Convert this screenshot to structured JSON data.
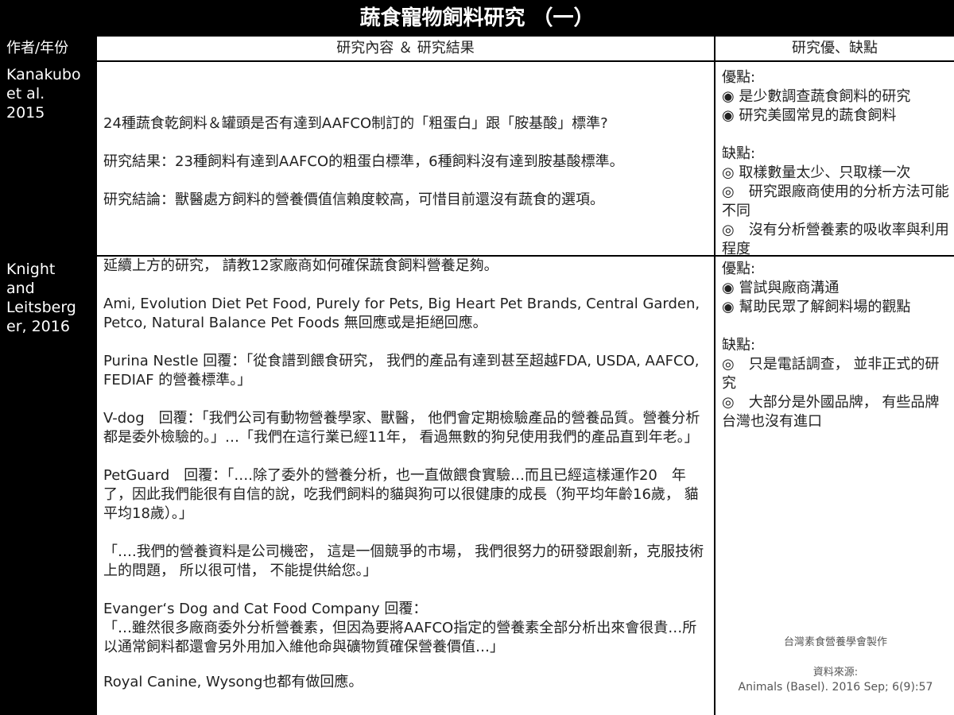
{
  "title": "蔬食寵物飼料研究 （一）",
  "headers": {
    "author": "作者/年份",
    "content": "研究內容 ＆ 研究結果",
    "evaluation": "研究優、缺點"
  },
  "rows": [
    {
      "author": "Kanakubo\net al.\n2015",
      "content": [
        "24種蔬食乾飼料＆罐頭是否有達到AAFCO制訂的「粗蛋白」跟「胺基酸」標準?",
        "研究結果：23種飼料有達到AAFCO的粗蛋白標準，6種飼料沒有達到胺基酸標準。",
        "研究結論：獸醫處方飼料的營養價值信賴度較高，可惜目前還沒有蔬食的選項。"
      ],
      "pros_label": "優點:",
      "pros": [
        "◉ 是少數調查蔬食飼料的研究",
        "◉ 研究美國常見的蔬食飼料"
      ],
      "cons_label": "缺點:",
      "cons": [
        "◎ 取樣數量太少、只取樣一次",
        "◎　研究跟廠商使用的分析方法可能不同",
        "◎　沒有分析營養素的吸收率與利用程度"
      ]
    },
    {
      "author": "Knight\nand\nLeitsberg\ner, 2016",
      "content": [
        "延續上方的研究， 請教12家廠商如何確保蔬食飼料營養足夠。",
        "Ami, Evolution Diet Pet Food, Purely for Pets, Big Heart Pet Brands, Central Garden, Petco, Natural Balance Pet Foods 無回應或是拒絕回應。",
        "Purina Nestle 回覆：「從食譜到餵食研究， 我們的產品有達到甚至超越FDA, USDA, AAFCO, FEDIAF 的營養標準。」",
        "V-dog　回覆：「我們公司有動物營養學家、獸醫， 他們會定期檢驗產品的營養品質。營養分析都是委外檢驗的。」…「我們在這行業已經11年， 看過無數的狗兒使用我們的產品直到年老。」",
        "PetGuard　回覆：「….除了委外的營養分析，也一直做餵食實驗…而且已經這樣運作20　年了，因此我們能很有自信的說，吃我們飼料的貓與狗可以很健康的成長（狗平均年齡16歲， 貓平均18歲）。」",
        "「….我們的營養資料是公司機密， 這是一個競爭的市場， 我們很努力的研發跟創新，克服技術上的問題， 所以很可惜， 不能提供給您。」",
        "Evanger‘s Dog and Cat Food Company 回覆：",
        "「…雖然很多廠商委外分析營養素，但因為要將AAFCO指定的營養素全部分析出來會很貴…所以通常飼料都還會另外用加入維他命與礦物質確保營養價值…」",
        "Royal Canine, Wysong也都有做回應。"
      ],
      "pros_label": "優點:",
      "pros": [
        "◉ 嘗試與廠商溝通",
        "◉ 幫助民眾了解飼料場的觀點"
      ],
      "cons_label": "缺點:",
      "cons": [
        "◎　只是電話調查， 並非正式的研究",
        "◎　大部分是外國品牌， 有些品牌台灣也沒有進口"
      ]
    }
  ],
  "credit": {
    "maker": "台灣素食營養學會製作",
    "source_label": "資料來源:",
    "source": "Animals (Basel). 2016 Sep; 6(9):57"
  }
}
